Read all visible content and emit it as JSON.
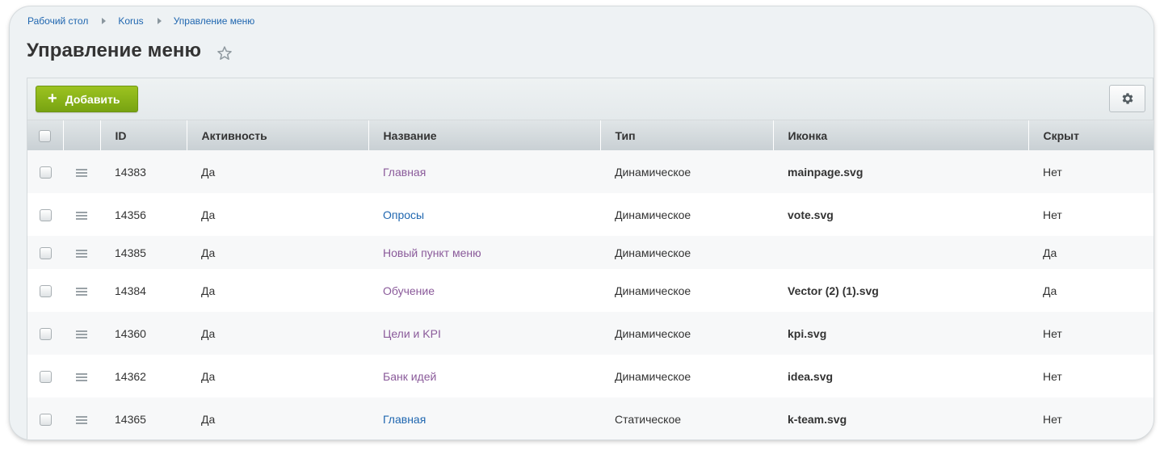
{
  "breadcrumb": [
    "Рабочий стол",
    "Korus",
    "Управление меню"
  ],
  "page_title": "Управление меню",
  "toolbar": {
    "add_label": "Добавить"
  },
  "columns": {
    "id": "ID",
    "active": "Активность",
    "name": "Название",
    "type": "Тип",
    "icon": "Иконка",
    "hidden": "Скрыт"
  },
  "rows": [
    {
      "id": "14383",
      "active": "Да",
      "name": "Главная",
      "type": "Динамическое",
      "icon": "mainpage.svg",
      "hidden": "Нет"
    },
    {
      "id": "14356",
      "active": "Да",
      "name": "Опросы",
      "type": "Динамическое",
      "icon": "vote.svg",
      "hidden": "Нет"
    },
    {
      "id": "14385",
      "active": "Да",
      "name": "Новый пункт меню",
      "type": "Динамическое",
      "icon": "",
      "hidden": "Да"
    },
    {
      "id": "14384",
      "active": "Да",
      "name": "Обучение",
      "type": "Динамическое",
      "icon": "Vector (2) (1).svg",
      "hidden": "Да"
    },
    {
      "id": "14360",
      "active": "Да",
      "name": "Цели и KPI",
      "type": "Динамическое",
      "icon": "kpi.svg",
      "hidden": "Нет"
    },
    {
      "id": "14362",
      "active": "Да",
      "name": "Банк идей",
      "type": "Динамическое",
      "icon": "idea.svg",
      "hidden": "Нет"
    },
    {
      "id": "14365",
      "active": "Да",
      "name": "Главная",
      "type": "Статическое",
      "icon": "k-team.svg",
      "hidden": "Нет"
    }
  ],
  "colors": {
    "link": "#2067b0",
    "link_visited": "#8a5a9a",
    "add_button": "#8ab51a"
  }
}
